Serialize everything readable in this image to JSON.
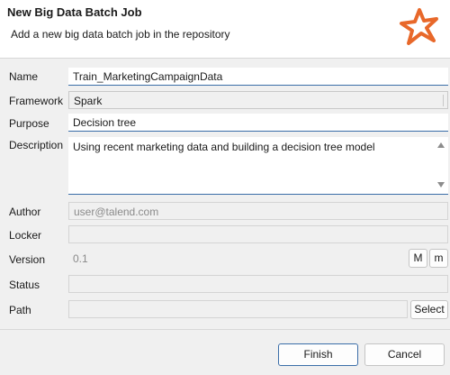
{
  "dialog": {
    "title": "New Big Data Batch Job",
    "description": "Add a new big data batch job in the repository",
    "logo_icon": "talend-star-icon",
    "accent_color": "#e8682a"
  },
  "form": {
    "name": {
      "label": "Name",
      "value": "Train_MarketingCampaignData"
    },
    "framework": {
      "label": "Framework",
      "value": "Spark"
    },
    "purpose": {
      "label": "Purpose",
      "value": "Decision tree"
    },
    "description": {
      "label": "Description",
      "value": "Using recent marketing data and building a decision tree model"
    },
    "author": {
      "label": "Author",
      "value": "user@talend.com"
    },
    "locker": {
      "label": "Locker",
      "value": ""
    },
    "version": {
      "label": "Version",
      "value": "0.1",
      "major_button": "M",
      "minor_button": "m"
    },
    "status": {
      "label": "Status",
      "value": ""
    },
    "path": {
      "label": "Path",
      "value": "",
      "select_button": "Select"
    }
  },
  "footer": {
    "finish_label": "Finish",
    "cancel_label": "Cancel"
  }
}
